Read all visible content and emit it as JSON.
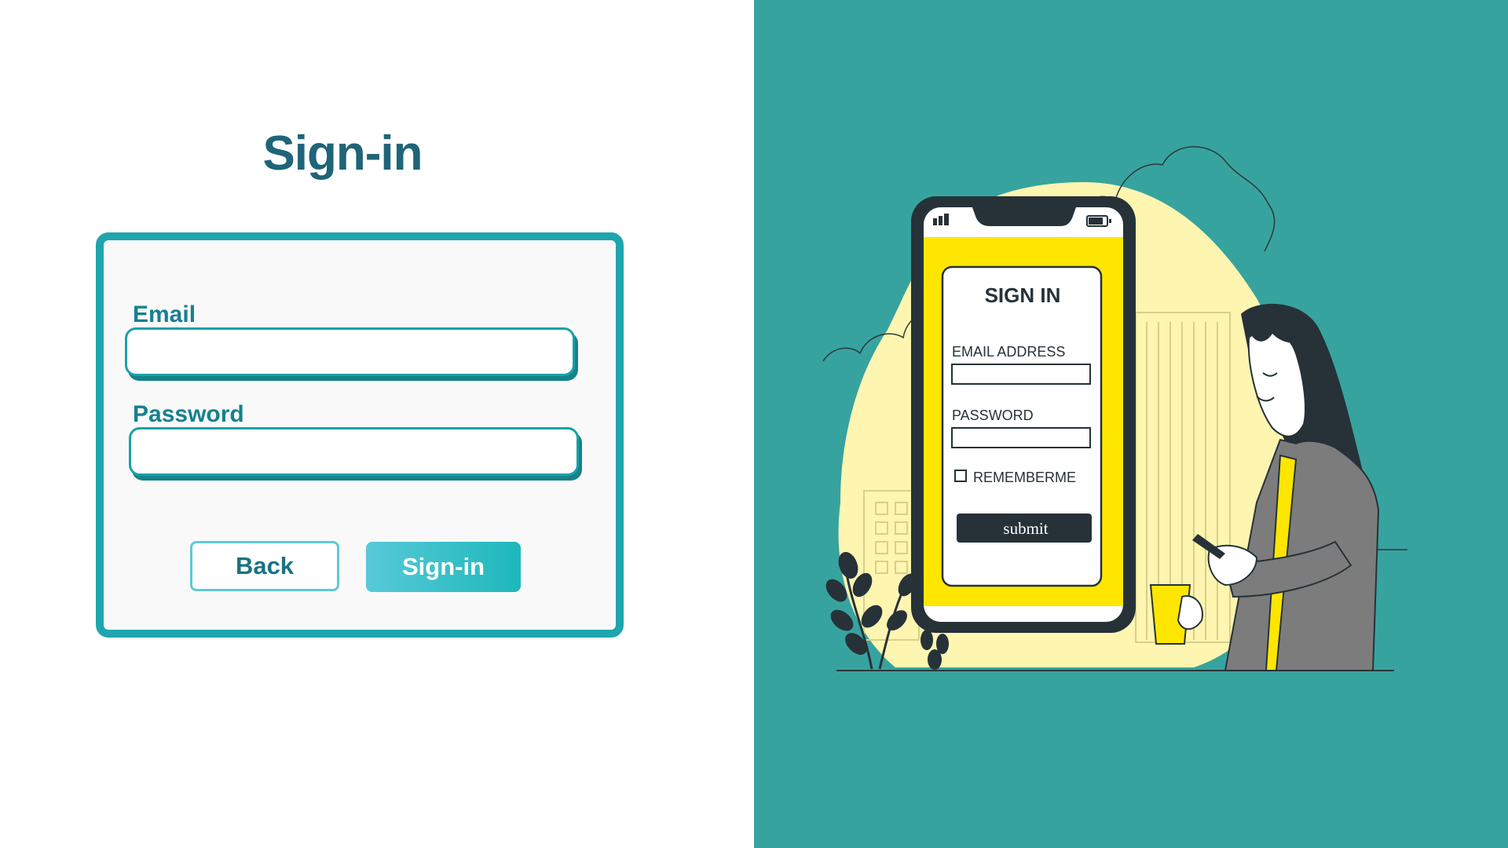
{
  "signin_form": {
    "title": "Sign-in",
    "email_label": "Email",
    "email_value": "",
    "password_label": "Password",
    "password_value": "",
    "back_button": "Back",
    "signin_button": "Sign-in"
  },
  "illustration": {
    "phone_title": "SIGN IN",
    "email_label": "EMAIL ADDRESS",
    "password_label": "PASSWORD",
    "remember_label": "REMEMBERME",
    "submit_label": "submit"
  },
  "colors": {
    "title": "#1f6478",
    "card_border": "#1ea5ad",
    "right_background": "#37a39f",
    "phone_screen": "#ffe600",
    "accent_blob": "#fdf5b0"
  }
}
